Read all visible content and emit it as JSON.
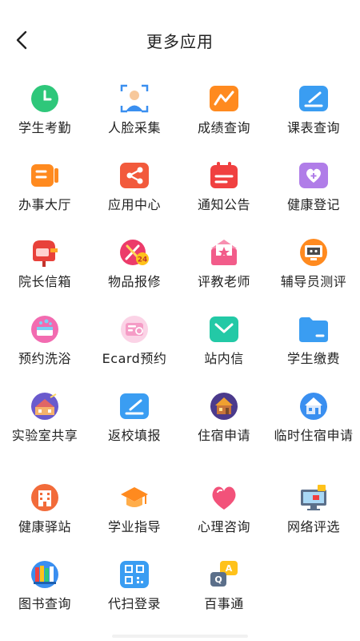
{
  "header": {
    "title": "更多应用"
  },
  "apps": [
    {
      "label": "学生考勤",
      "icon": "clock-icon"
    },
    {
      "label": "人脸采集",
      "icon": "face-scan-icon"
    },
    {
      "label": "成绩查询",
      "icon": "chart-icon"
    },
    {
      "label": "课表查询",
      "icon": "schedule-icon"
    },
    {
      "label": "办事大厅",
      "icon": "video-icon"
    },
    {
      "label": "应用中心",
      "icon": "share-icon"
    },
    {
      "label": "通知公告",
      "icon": "calendar-icon"
    },
    {
      "label": "健康登记",
      "icon": "heart-card-icon"
    },
    {
      "label": "院长信箱",
      "icon": "mailbox-icon"
    },
    {
      "label": "物品报修",
      "icon": "repair-icon"
    },
    {
      "label": "评教老师",
      "icon": "star-envelope-icon"
    },
    {
      "label": "辅导员测评",
      "icon": "monitor-icon"
    },
    {
      "label": "预约洗浴",
      "icon": "bath-icon"
    },
    {
      "label": "Ecard预约",
      "icon": "ecard-icon"
    },
    {
      "label": "站内信",
      "icon": "message-icon"
    },
    {
      "label": "学生缴费",
      "icon": "folder-icon"
    },
    {
      "label": "实验室共享",
      "icon": "lab-icon"
    },
    {
      "label": "返校填报",
      "icon": "form-icon"
    },
    {
      "label": "住宿申请",
      "icon": "house-icon"
    },
    {
      "label": "临时住宿申请",
      "icon": "home-icon"
    },
    {
      "label": "健康驿站",
      "icon": "hospital-icon"
    },
    {
      "label": "学业指导",
      "icon": "graduation-cap-icon"
    },
    {
      "label": "心理咨询",
      "icon": "heart-icon"
    },
    {
      "label": "网络评选",
      "icon": "computer-icon"
    },
    {
      "label": "图书查询",
      "icon": "books-icon"
    },
    {
      "label": "代扫登录",
      "icon": "qr-code-icon"
    },
    {
      "label": "百事通",
      "icon": "qa-bubble-icon"
    }
  ],
  "colors": {
    "green": "#2ec77a",
    "blue": "#3a8ff0",
    "orange": "#ff8a1f",
    "red": "#f04040",
    "purple": "#b07de8",
    "pink": "#f25c8a",
    "teal": "#23c9a6"
  }
}
